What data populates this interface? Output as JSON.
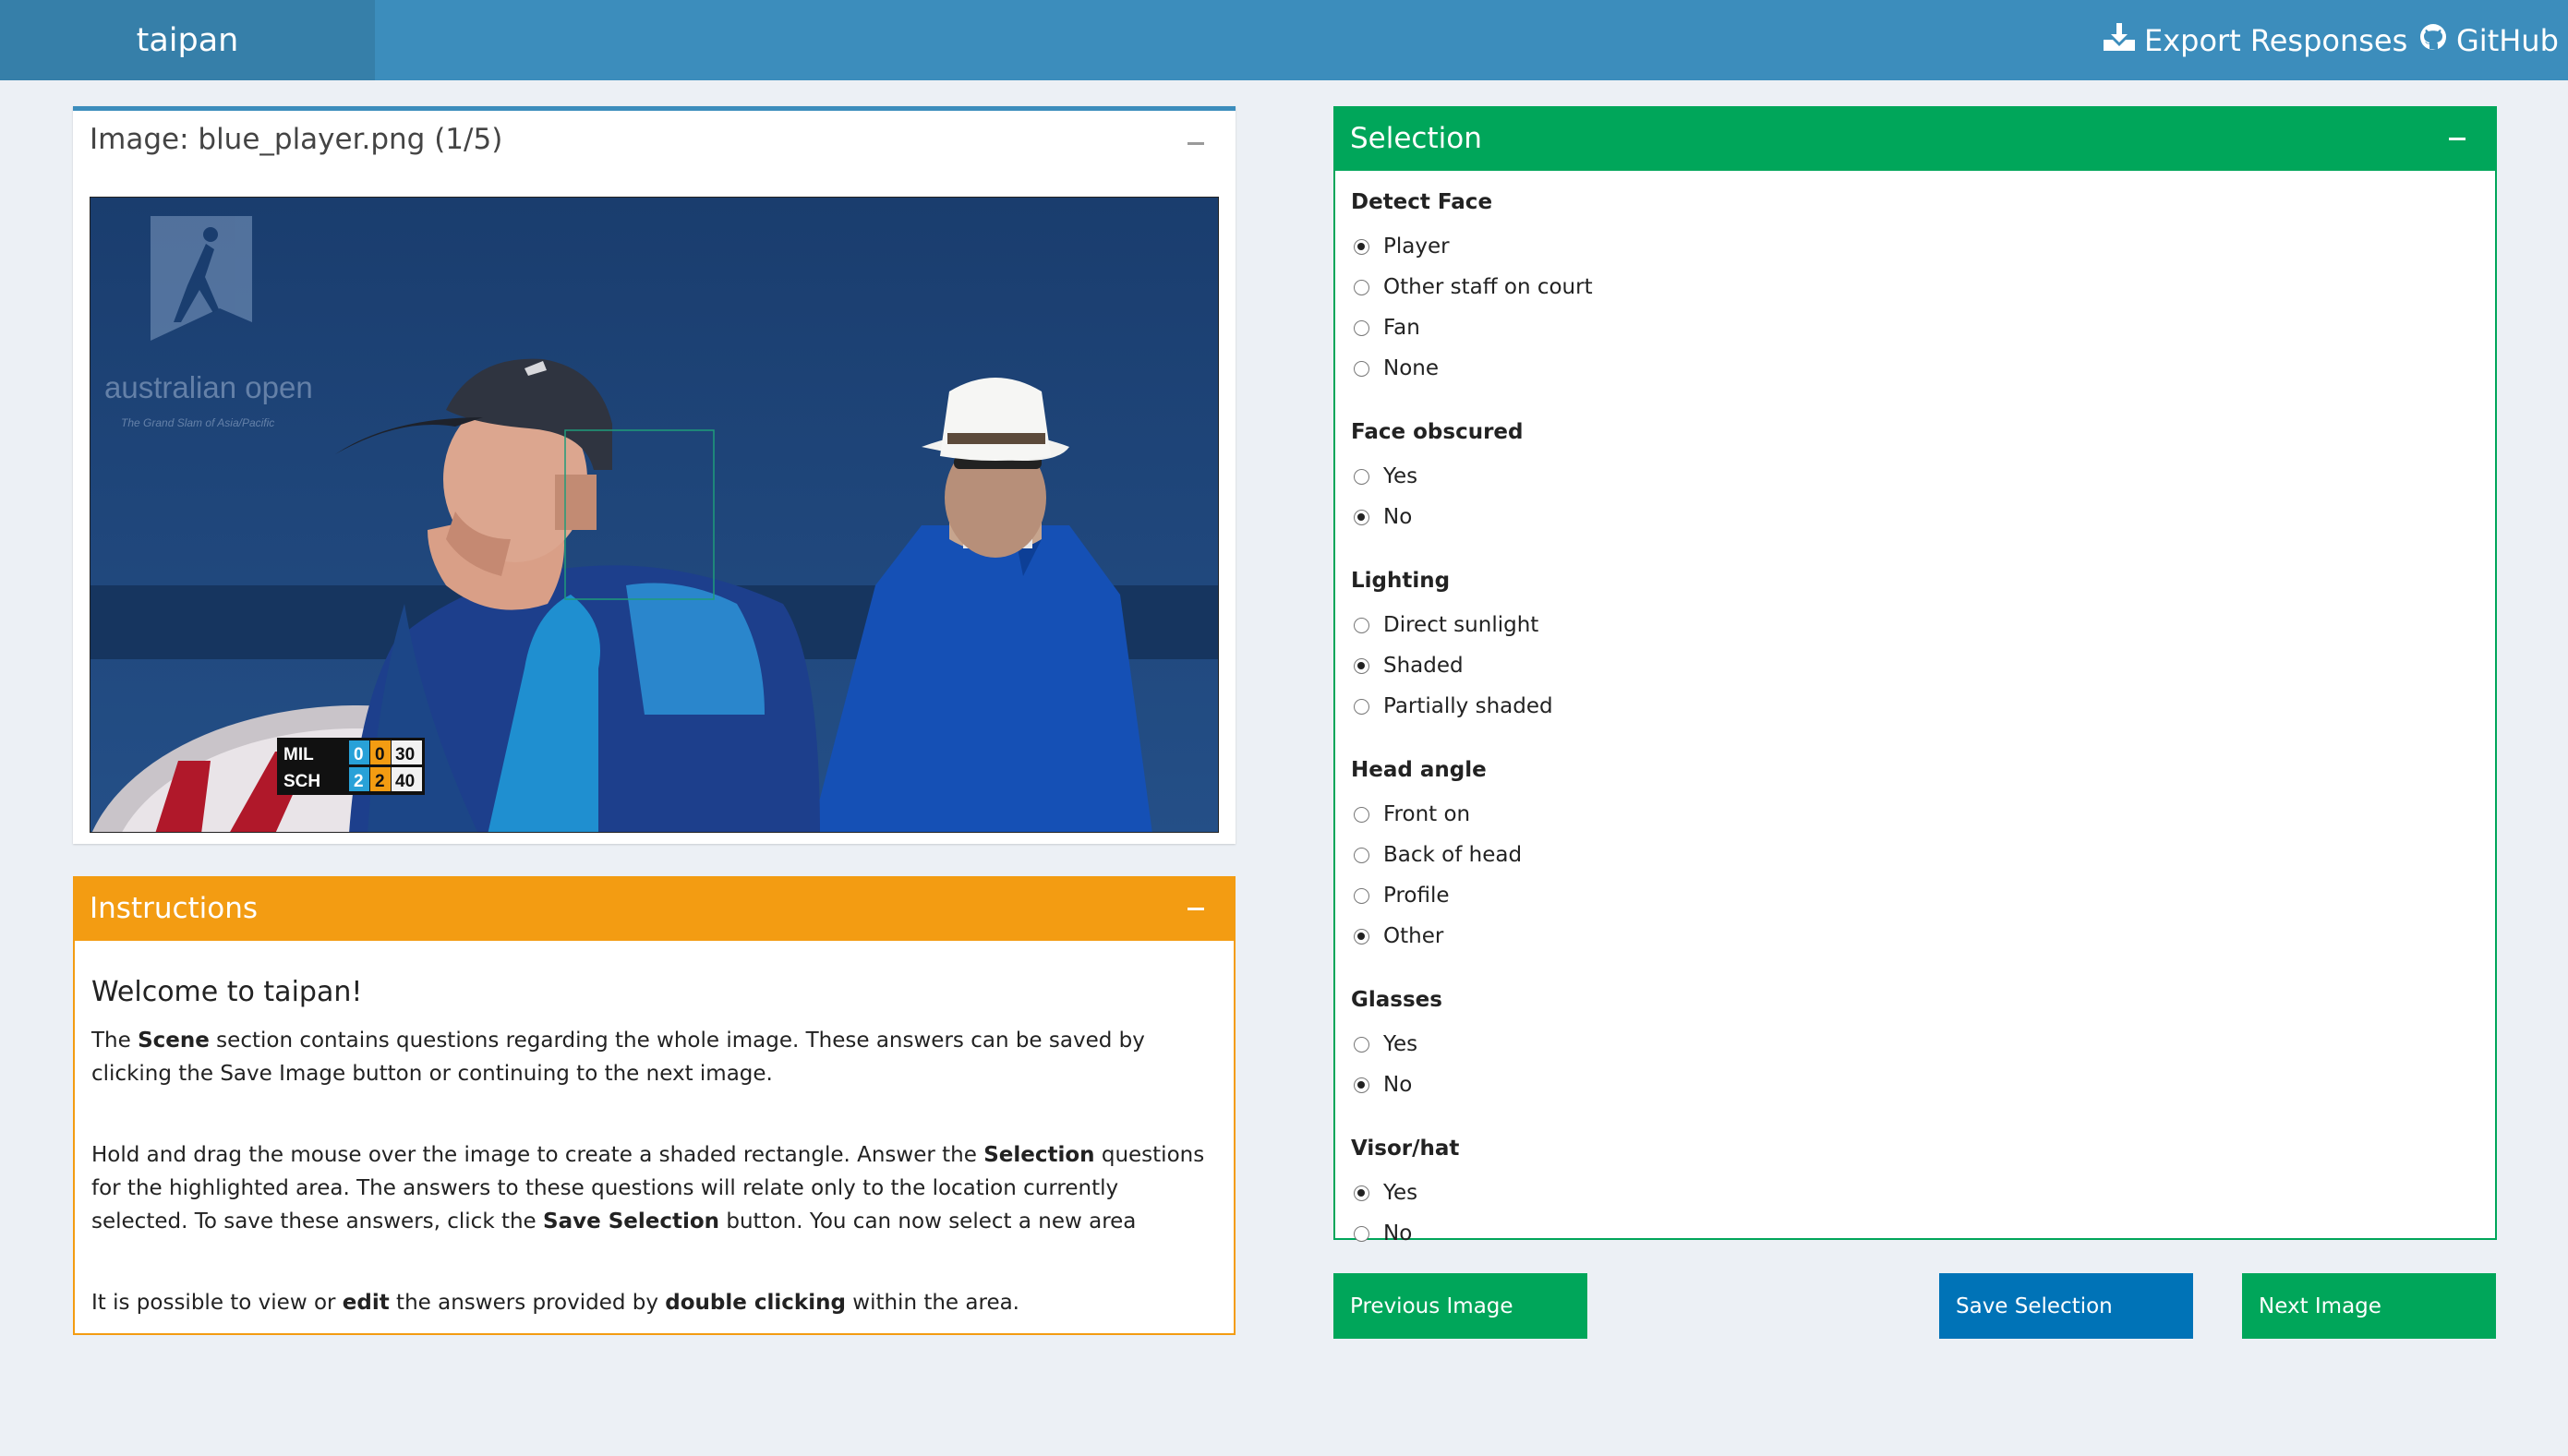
{
  "header": {
    "logo": "taipan",
    "export_label": "Export Responses",
    "github_label": "GitHub"
  },
  "image_panel": {
    "title": "Image: blue_player.png (1/5)",
    "watermark": "australian open",
    "watermark_sub": "The Grand Slam of Asia/Pacific",
    "scoreboard": {
      "rows": [
        {
          "name": "MIL",
          "sets": "0",
          "games": "0",
          "points": "30"
        },
        {
          "name": "SCH",
          "sets": "2",
          "games": "2",
          "points": "40"
        }
      ]
    }
  },
  "instructions": {
    "title": "Instructions",
    "heading": "Welcome to taipan!",
    "p1": {
      "a": "The ",
      "b": "Scene",
      "c": " section contains questions regarding the whole image. These answers can be saved by clicking the Save Image button or continuing to the next image."
    },
    "p2": {
      "a": "Hold and drag the mouse over the image to create a shaded rectangle. Answer the ",
      "b": "Selection",
      "c": " questions for the highlighted area. The answers to these questions will relate only to the location currently selected. To save these answers, click the ",
      "d": "Save Selection",
      "e": " button. You can now select a new area"
    },
    "p3": {
      "a": "It is possible to view or ",
      "b": "edit",
      "c": " the answers provided by ",
      "d": "double clicking",
      "e": " within the area."
    }
  },
  "selection": {
    "title": "Selection",
    "questions": [
      {
        "label": "Detect Face",
        "options": [
          {
            "label": "Player",
            "checked": true
          },
          {
            "label": "Other staff on court",
            "checked": false
          },
          {
            "label": "Fan",
            "checked": false
          },
          {
            "label": "None",
            "checked": false
          }
        ]
      },
      {
        "label": "Face obscured",
        "options": [
          {
            "label": "Yes",
            "checked": false
          },
          {
            "label": "No",
            "checked": true
          }
        ]
      },
      {
        "label": "Lighting",
        "options": [
          {
            "label": "Direct sunlight",
            "checked": false
          },
          {
            "label": "Shaded",
            "checked": true
          },
          {
            "label": "Partially shaded",
            "checked": false
          }
        ]
      },
      {
        "label": "Head angle",
        "options": [
          {
            "label": "Front on",
            "checked": false
          },
          {
            "label": "Back of head",
            "checked": false
          },
          {
            "label": "Profile",
            "checked": false
          },
          {
            "label": "Other",
            "checked": true
          }
        ]
      },
      {
        "label": "Glasses",
        "options": [
          {
            "label": "Yes",
            "checked": false
          },
          {
            "label": "No",
            "checked": true
          }
        ]
      },
      {
        "label": "Visor/hat",
        "options": [
          {
            "label": "Yes",
            "checked": true
          },
          {
            "label": "No",
            "checked": false
          }
        ]
      }
    ]
  },
  "buttons": {
    "previous": "Previous Image",
    "save": "Save Selection",
    "next": "Next Image"
  },
  "colors": {
    "header": "#3c8dbc",
    "logo_bg": "#367fa9",
    "instructions_accent": "#f39c12",
    "selection_accent": "#00a65a",
    "save_button": "#0073b7"
  }
}
